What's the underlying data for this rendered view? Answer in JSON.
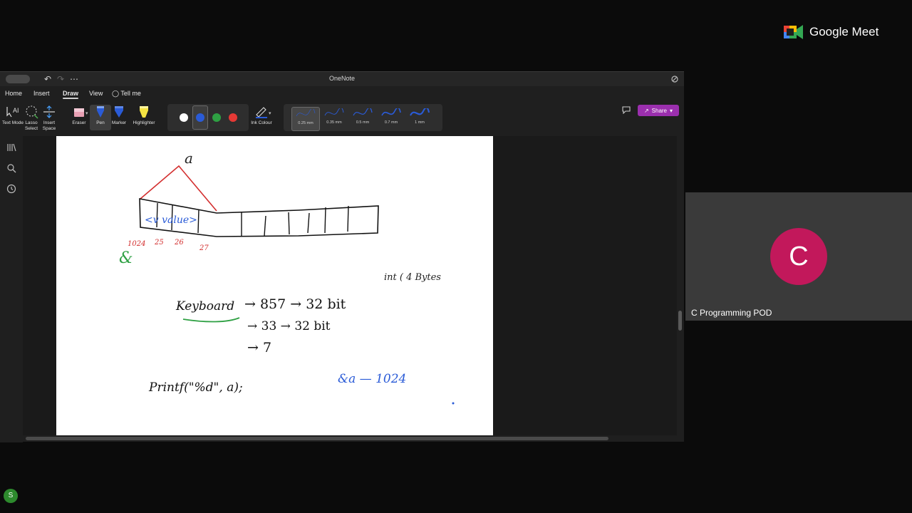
{
  "meet": {
    "brand": "Google Meet",
    "participant": {
      "initial": "C",
      "name": "C Programming POD"
    },
    "avatar_color": "#c2185b"
  },
  "onenote": {
    "app_title": "OneNote",
    "tabs": [
      {
        "label": "Home"
      },
      {
        "label": "Insert"
      },
      {
        "label": "Draw"
      },
      {
        "label": "View"
      },
      {
        "label": "Tell me"
      }
    ],
    "active_tab": "Draw",
    "share_label": "Share",
    "tools": {
      "text_mode": "Text Mode",
      "lasso_select": "Lasso Select",
      "insert_space": "Insert Space",
      "eraser": "Eraser",
      "pen": "Pen",
      "marker": "Marker",
      "highlighter": "Highlighter",
      "ink_colour": "Ink Colour"
    },
    "ink_colors": [
      "#ffffff",
      "#2a5bd7",
      "#2ea043",
      "#e53935"
    ],
    "thicknesses": [
      "0.25 mm",
      "0.35 mm",
      "0.5 mm",
      "0.7 mm",
      "1 mm"
    ],
    "user_initial": "S"
  },
  "sketch": {
    "var_a": "a",
    "value_label": "<v value>",
    "addresses": [
      "1024",
      "25",
      "26",
      "27"
    ],
    "amp": "&",
    "int_note": "int ( 4 Bytes",
    "keyboard": "Keyboard",
    "line1": "→ 857 → 32 bit",
    "line2": "→ 33 → 32 bit",
    "line3": "→ 7",
    "printf": "Printf(\"%d\", a);",
    "addr_of_a": "&a — 1024"
  }
}
